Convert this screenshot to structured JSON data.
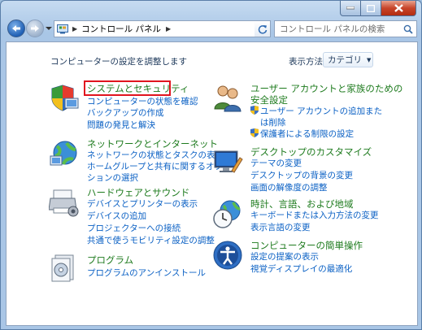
{
  "nav": {
    "address_text": "コントロール パネル",
    "search_placeholder": "コントロール パネルの検索"
  },
  "header": {
    "heading": "コンピューターの設定を調整します",
    "view_by_label": "表示方法:",
    "view_by_value": "カテゴリ"
  },
  "left_categories": [
    {
      "title": "システムとセキュリティ",
      "links": [
        "コンピューターの状態を確認",
        "バックアップの作成",
        "問題の発見と解決"
      ]
    },
    {
      "title": "ネットワークとインターネット",
      "links": [
        "ネットワークの状態とタスクの表示",
        "ホームグループと共有に関するオプ",
        "ションの選択"
      ]
    },
    {
      "title": "ハードウェアとサウンド",
      "links": [
        "デバイスとプリンターの表示",
        "デバイスの追加",
        "プロジェクターへの接続",
        "共通で使うモビリティ設定の調整"
      ]
    },
    {
      "title": "プログラム",
      "links": [
        "プログラムのアンインストール"
      ]
    }
  ],
  "right_categories": [
    {
      "title_lines": [
        "ユーザー アカウントと家族のための",
        "安全設定"
      ],
      "links": [
        "ユーザー アカウントの追加また",
        "は削除",
        "保護者による制限の設定"
      ]
    },
    {
      "title_lines": [
        "デスクトップのカスタマイズ"
      ],
      "links": [
        "テーマの変更",
        "デスクトップの背景の変更",
        "画面の解像度の調整"
      ]
    },
    {
      "title_lines": [
        "時計、言語、および地域"
      ],
      "links": [
        "キーボードまたは入力方法の変更",
        "表示言語の変更"
      ]
    },
    {
      "title_lines": [
        "コンピューターの簡単操作"
      ],
      "links": [
        "設定の提案の表示",
        "視覚ディスプレイの最適化"
      ]
    }
  ],
  "colors": {
    "category_title": "#1e7b1e",
    "link": "#0a60c4",
    "highlight_border": "#e0141e"
  }
}
